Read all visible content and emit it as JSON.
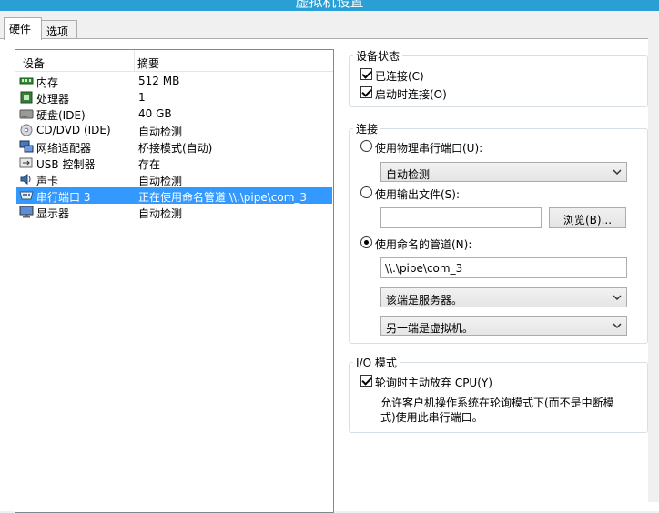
{
  "window": {
    "title": "虚拟机设置"
  },
  "tabs": [
    {
      "label": "硬件"
    },
    {
      "label": "选项"
    }
  ],
  "device_list": {
    "headers": {
      "device": "设备",
      "summary": "摘要"
    },
    "rows": [
      {
        "name": "内存",
        "summary": "512 MB",
        "icon": "memory-icon"
      },
      {
        "name": "处理器",
        "summary": "1",
        "icon": "processor-icon"
      },
      {
        "name": "硬盘(IDE)",
        "summary": "40 GB",
        "icon": "hard-disk-icon"
      },
      {
        "name": "CD/DVD (IDE)",
        "summary": "自动检测",
        "icon": "cd-dvd-icon"
      },
      {
        "name": "网络适配器",
        "summary": "桥接模式(自动)",
        "icon": "network-adapter-icon"
      },
      {
        "name": "USB 控制器",
        "summary": "存在",
        "icon": "usb-icon"
      },
      {
        "name": "声卡",
        "summary": "自动检测",
        "icon": "sound-card-icon"
      },
      {
        "name": "串行端口 3",
        "summary": "正在使用命名管道 \\\\.\\pipe\\com_3",
        "icon": "serial-port-icon",
        "selected": true
      },
      {
        "name": "显示器",
        "summary": "自动检测",
        "icon": "display-icon"
      }
    ]
  },
  "device_status": {
    "title": "设备状态",
    "connected": {
      "label": "已连接(C)",
      "checked": true
    },
    "connect_at_power_on": {
      "label": "启动时连接(O)",
      "checked": true
    }
  },
  "connection": {
    "title": "连接",
    "physical_port": {
      "label": "使用物理串行端口(U):",
      "selected": false,
      "combo_value": "自动检测"
    },
    "output_file": {
      "label": "使用输出文件(S):",
      "selected": false,
      "path_value": "",
      "browse_label": "浏览(B)..."
    },
    "named_pipe": {
      "label": "使用命名的管道(N):",
      "selected": true,
      "pipe_value": "\\\\.\\pipe\\com_3",
      "this_end": "该端是服务器。",
      "other_end": "另一端是虚拟机。"
    }
  },
  "io_mode": {
    "title": "I/O 模式",
    "yield_cpu": {
      "label": "轮询时主动放弃 CPU(Y)",
      "checked": true
    },
    "description_line1": "允许客户机操作系统在轮询模式下(而不是中断模",
    "description_line2": "式)使用此串行端口。"
  },
  "colors": {
    "selection": "#3399ff",
    "titlebar": "#2a9fd6"
  }
}
